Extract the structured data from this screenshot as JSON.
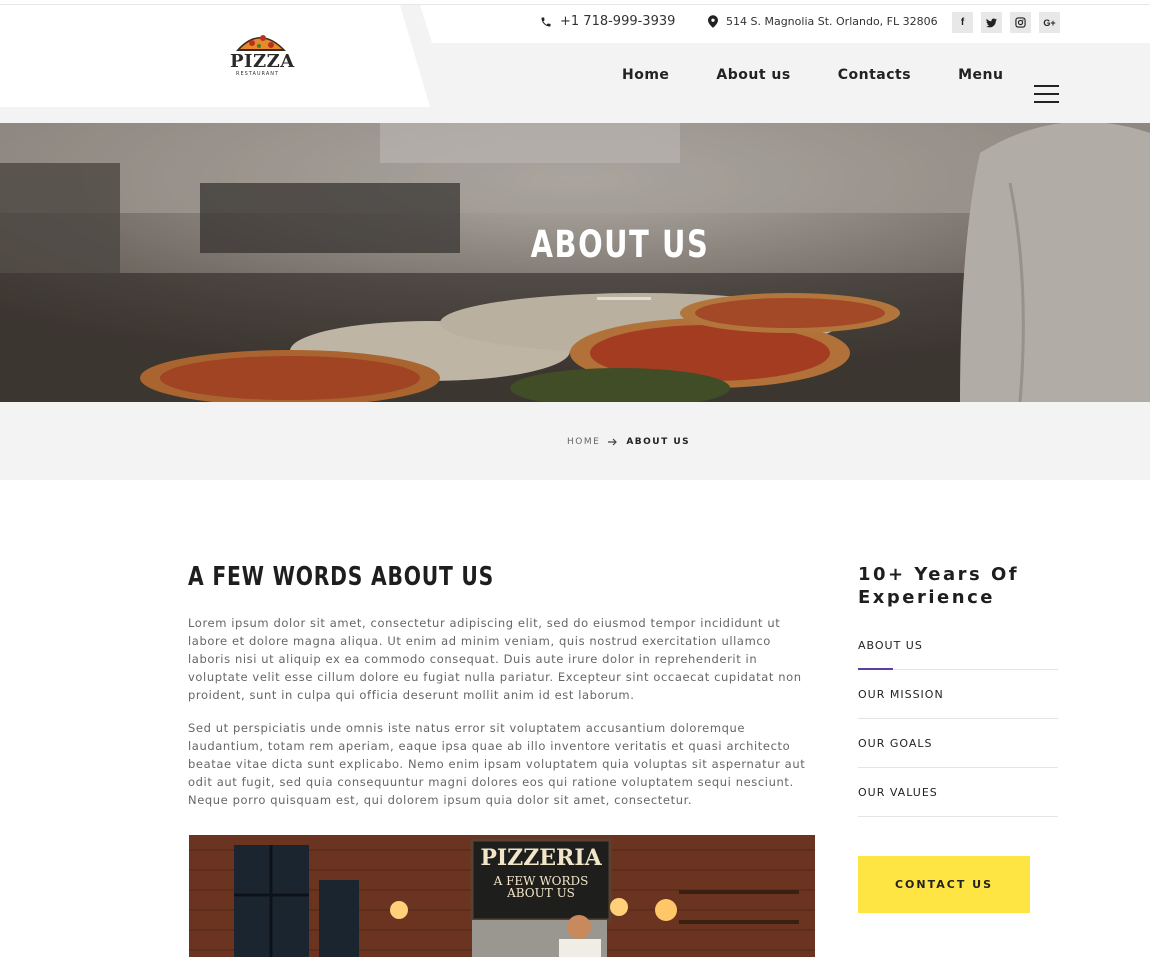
{
  "header": {
    "logo": {
      "word": "PIZZA",
      "sub": "RESTAURANT"
    },
    "phone": "+1 718-999-3939",
    "address": "514 S. Magnolia St. Orlando, FL 32806",
    "socials": [
      {
        "icon": "facebook-icon",
        "glyph": "f"
      },
      {
        "icon": "twitter-icon",
        "glyph": "t"
      },
      {
        "icon": "instagram-icon",
        "glyph": "◎"
      },
      {
        "icon": "google-plus-icon",
        "glyph": "G+"
      }
    ],
    "nav": [
      "Home",
      "About us",
      "Contacts",
      "Menu"
    ]
  },
  "hero": {
    "title": "ABOUT US"
  },
  "breadcrumb": {
    "home": "HOME",
    "current": "ABOUT US"
  },
  "main": {
    "title": "A FEW WORDS ABOUT US",
    "para1": "Lorem ipsum dolor sit amet, consectetur adipiscing elit, sed do eiusmod tempor incididunt ut labore et dolore magna aliqua. Ut enim ad minim veniam, quis nostrud exercitation ullamco laboris nisi ut aliquip ex ea commodo consequat. Duis aute irure dolor in reprehenderit in voluptate velit esse cillum dolore eu fugiat nulla pariatur. Excepteur sint occaecat cupidatat non proident, sunt in culpa qui officia deserunt mollit anim id est laborum.",
    "para2": "Sed ut perspiciatis unde omnis iste natus error sit voluptatem accusantium doloremque laudantium, totam rem aperiam, eaque ipsa quae ab illo inventore veritatis et quasi architecto beatae vitae dicta sunt explicabo. Nemo enim ipsam voluptatem quia voluptas sit aspernatur aut odit aut fugit, sed quia consequuntur magni dolores eos qui ratione voluptatem sequi nesciunt. Neque porro quisquam est, qui dolorem ipsum quia dolor sit amet, consectetur.",
    "image": {
      "sign_title": "PIZZERIA",
      "sign_line1": "A FEW WORDS",
      "sign_line2": "ABOUT US"
    }
  },
  "sidebar": {
    "title": "10+ Years Of Experience",
    "items": [
      "ABOUT US",
      "OUR MISSION",
      "OUR GOALS",
      "OUR VALUES"
    ],
    "active_index": 0,
    "contact_button": "CONTACT US"
  },
  "colors": {
    "accent_yellow": "#ffe543",
    "active_underline": "#5c3fa3",
    "header_bg": "#f3f3f3"
  }
}
